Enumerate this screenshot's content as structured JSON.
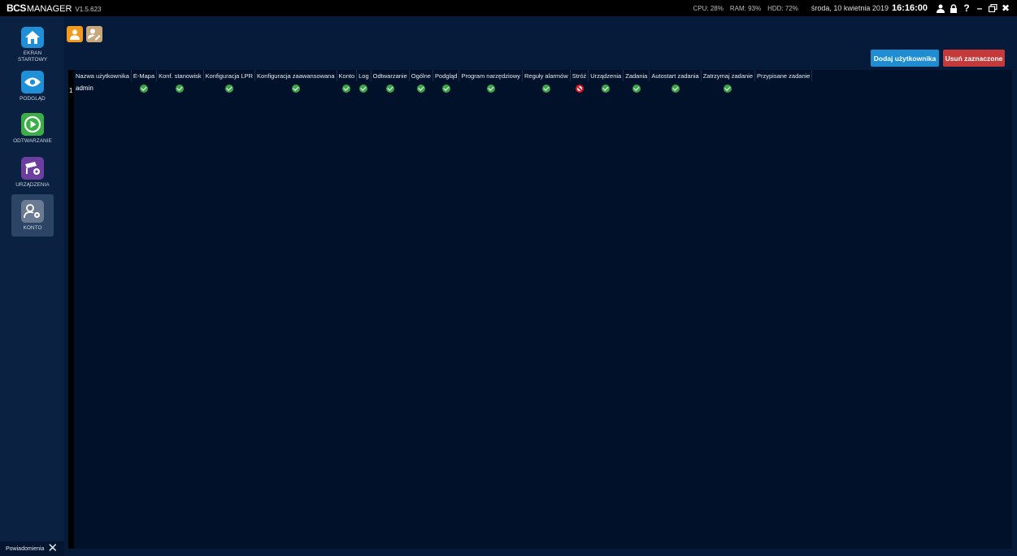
{
  "app": {
    "brand_bcs": "BCS",
    "brand_manager": "MANAGER",
    "version": "V1.5.623"
  },
  "status": {
    "cpu": "CPU: 28%",
    "ram": "RAM: 93%",
    "hdd": "HDD: 72%",
    "date": "środa, 10 kwietnia 2019",
    "time": "16:16:00"
  },
  "window_controls": {
    "user": "user-icon",
    "lock": "lock-icon",
    "help": "?",
    "minimize": "–",
    "restore": "restore-icon",
    "close": "✖"
  },
  "sidebar": {
    "items": [
      {
        "label": "EKRAN STARTOWY",
        "icon": "home-icon",
        "color": "#1f8fd8"
      },
      {
        "label": "PODGLĄD",
        "icon": "eye-icon",
        "color": "#1f8fd8"
      },
      {
        "label": "ODTWARZANIE",
        "icon": "play-icon",
        "color": "#3cae48"
      },
      {
        "label": "URZĄDZENIA",
        "icon": "camera-settings-icon",
        "color": "#6b3ea0"
      },
      {
        "label": "KONTO",
        "icon": "user-settings-icon",
        "color": "#6a7a92"
      }
    ],
    "notifications_label": "Powiadomienia"
  },
  "toolbar": {
    "tab_icons": [
      {
        "icon": "user-icon",
        "color": "#f39a1e"
      },
      {
        "icon": "user-edit-icon",
        "color": "#c9a77c"
      }
    ],
    "add_user_label": "Dodaj użytkownika",
    "delete_selected_label": "Usuń zaznaczone"
  },
  "table": {
    "columns": [
      "Nazwa użytkownika",
      "E-Mapa",
      "Konf. stanowisk",
      "Konfiguracja LPR",
      "Konfiguracja zaawansowana",
      "Konto",
      "Log",
      "Odtwarzanie",
      "Ogólne",
      "Podgląd",
      "Program narzędziowy",
      "Reguły alarmów",
      "Stróż",
      "Urządzenia",
      "Zadania",
      "Autostart zadania",
      "Zatrzymaj zadanie",
      "Przypisane zadanie"
    ],
    "rows": [
      {
        "num": "1",
        "name": "admin",
        "perms": [
          "allowed",
          "allowed",
          "allowed",
          "allowed",
          "allowed",
          "allowed",
          "allowed",
          "allowed",
          "allowed",
          "allowed",
          "allowed",
          "denied",
          "allowed",
          "allowed",
          "allowed",
          "allowed",
          ""
        ]
      }
    ]
  },
  "colors": {
    "accent_blue": "#1e8dd2",
    "danger_red": "#c43a3a",
    "ok_green": "#3ea54a",
    "bg_main": "#061b3a",
    "bg_sidebar": "#0a2142"
  }
}
